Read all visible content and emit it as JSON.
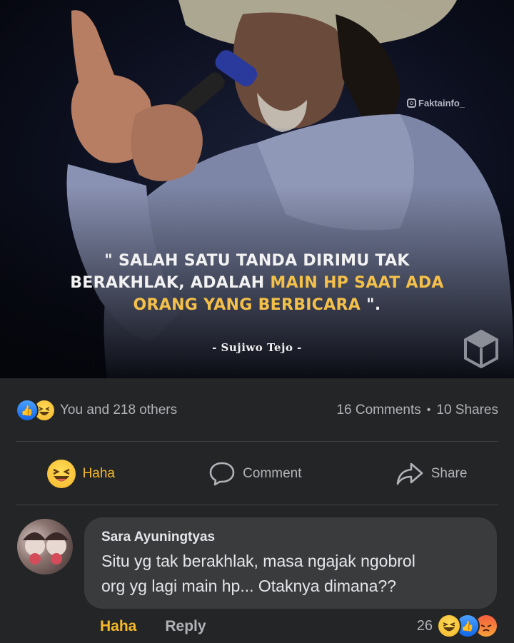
{
  "post": {
    "watermark": "Faktainfo_",
    "quote": {
      "line1": "\" SALAH SATU TANDA DIRIMU TAK",
      "line2_white": "BERAKHLAK, ADALAH ",
      "line2_yellow": "MAIN HP SAAT ADA",
      "line3_yellow": "ORANG YANG BERBICARA",
      "line3_white": " \"."
    },
    "attribution": "- Sujiwo Tejo -"
  },
  "reactions": {
    "summary_text": "You and 218 others",
    "comments_count": "16 Comments",
    "separator": "•",
    "shares_count": "10 Shares"
  },
  "actions": {
    "haha_label": "Haha",
    "comment_label": "Comment",
    "share_label": "Share"
  },
  "comment": {
    "author": "Sara Ayuningtyas",
    "text_line1": "Situ yg tak berakhlak, masa ngajak ngobrol",
    "text_line2": "org yg lagi main hp... Otaknya dimana??",
    "haha_label": "Haha",
    "reply_label": "Reply",
    "reaction_count": "26"
  },
  "colors": {
    "background": "#242526",
    "bubble": "#3a3b3c",
    "haha_yellow": "#f7b928",
    "like_blue": "#1877f2",
    "quote_highlight": "#f4c04a"
  }
}
